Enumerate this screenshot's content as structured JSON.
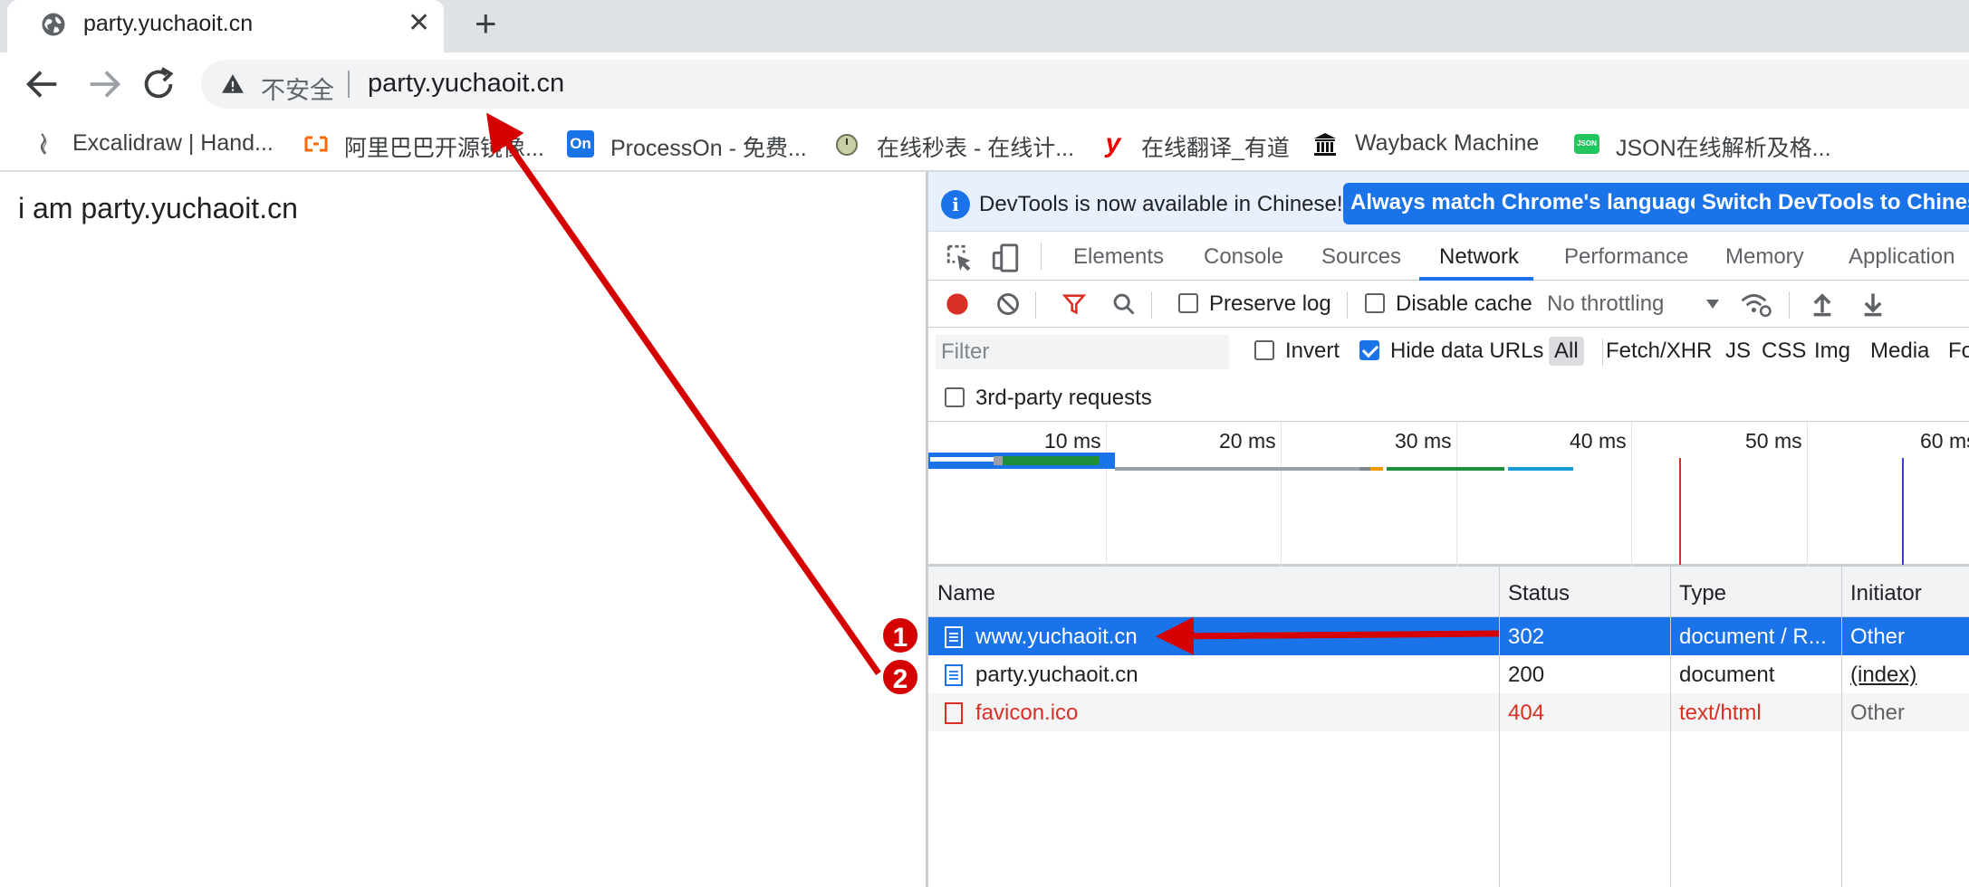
{
  "tab": {
    "title": "party.yuchaoit.cn",
    "close": "✕",
    "new_tab": "+"
  },
  "omnibox": {
    "security_label": "不安全",
    "url": "party.yuchaoit.cn"
  },
  "bookmarks": [
    {
      "label": "Excalidraw | Hand...",
      "icon": "excalidraw-icon"
    },
    {
      "label": "阿里巴巴开源镜像...",
      "icon": "alibaba-icon"
    },
    {
      "label": "ProcessOn - 免费...",
      "icon": "processon-icon",
      "icon_text": "On"
    },
    {
      "label": "在线秒表 - 在线计...",
      "icon": "stopwatch-icon"
    },
    {
      "label": "在线翻译_有道",
      "icon": "youdao-icon",
      "icon_text": "y"
    },
    {
      "label": "Wayback Machine",
      "icon": "wayback-icon"
    },
    {
      "label": "JSON在线解析及格...",
      "icon": "json-icon",
      "icon_text": "JSON"
    }
  ],
  "page": {
    "text": "i am party.yuchaoit.cn"
  },
  "devtools": {
    "infobar": {
      "message": "DevTools is now available in Chinese!",
      "btn_match": "Always match Chrome's language",
      "btn_switch": "Switch DevTools to Chinese"
    },
    "tabs": [
      "Elements",
      "Console",
      "Sources",
      "Network",
      "Performance",
      "Memory",
      "Application"
    ],
    "active_tab": "Network",
    "toolbar": {
      "preserve_log": "Preserve log",
      "disable_cache": "Disable cache",
      "throttling": "No throttling"
    },
    "filter": {
      "placeholder": "Filter",
      "invert": "Invert",
      "hide_data_urls": "Hide data URLs",
      "types": [
        "All",
        "Fetch/XHR",
        "JS",
        "CSS",
        "Img",
        "Media",
        "Fo"
      ]
    },
    "third_party": "3rd-party requests",
    "timeline_labels": [
      "10 ms",
      "20 ms",
      "30 ms",
      "40 ms",
      "50 ms",
      "60 ms"
    ],
    "columns": {
      "name": "Name",
      "status": "Status",
      "type": "Type",
      "initiator": "Initiator"
    },
    "rows": [
      {
        "name": "www.yuchaoit.cn",
        "status": "302",
        "type": "document / R...",
        "initiator": "Other",
        "selected": true,
        "error": false
      },
      {
        "name": "party.yuchaoit.cn",
        "status": "200",
        "type": "document",
        "initiator": "(index)",
        "selected": false,
        "error": false
      },
      {
        "name": "favicon.ico",
        "status": "404",
        "type": "text/html",
        "initiator": "Other",
        "selected": false,
        "error": true
      }
    ]
  },
  "annotations": {
    "badge1": "1",
    "badge2": "2"
  },
  "colors": {
    "accent": "#1a73e8",
    "arrow": "#d50000",
    "error": "#d93025"
  }
}
